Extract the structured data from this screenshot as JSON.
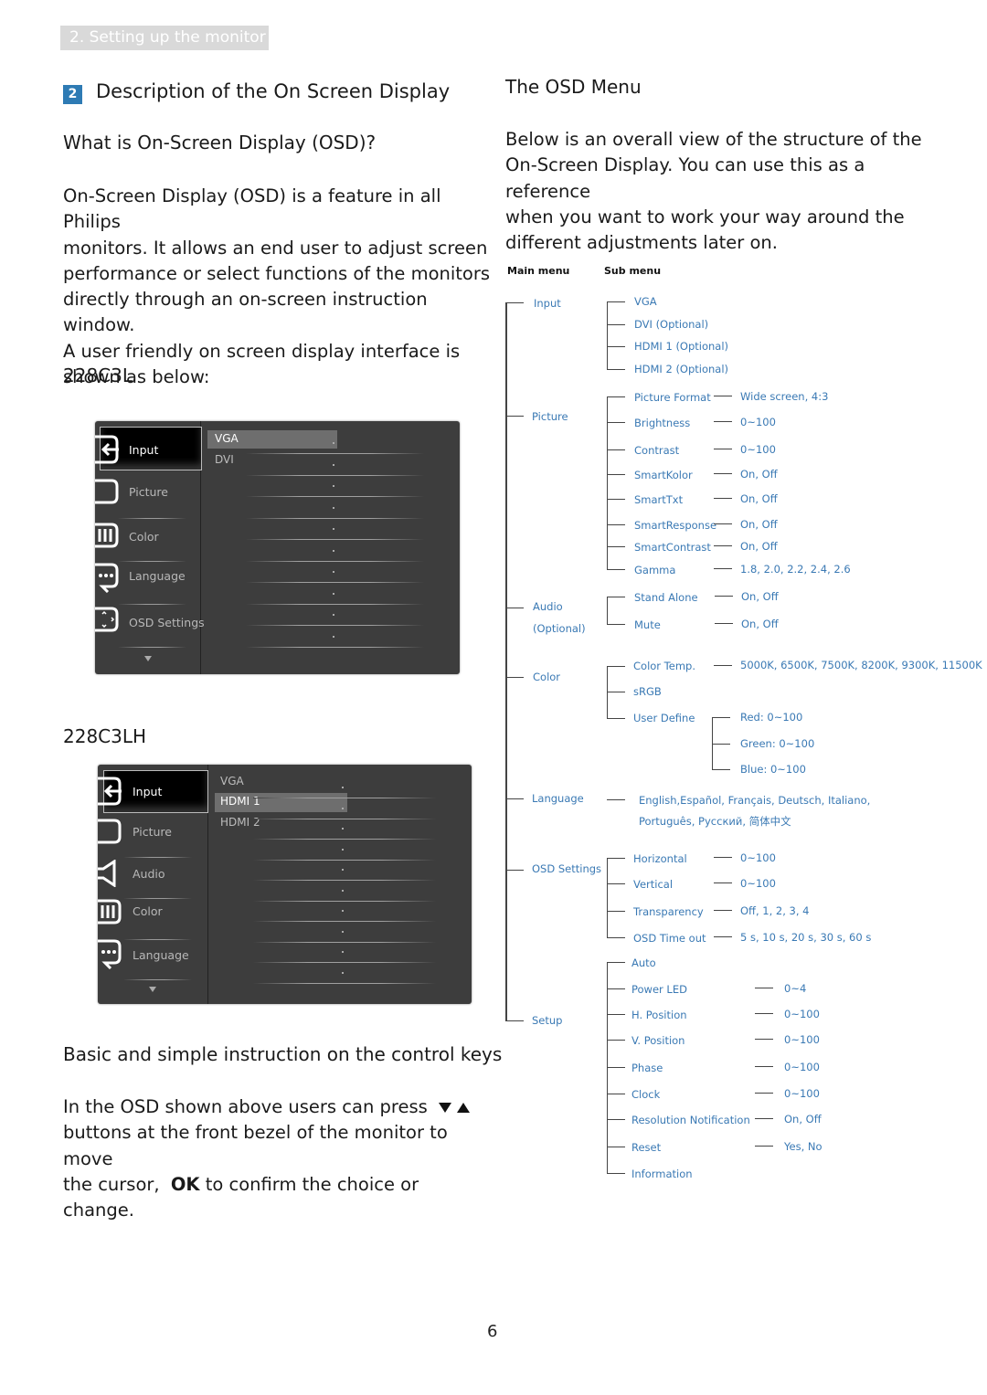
{
  "header": {
    "section_tab": "2. Setting up the monitor",
    "badge_number": "2",
    "title": "Description of the On Screen Display"
  },
  "left": {
    "question": "What is On-Screen Display (OSD)?",
    "intro_lines": [
      "On-Screen Display (OSD) is a feature in all Philips",
      "monitors. It allows an end user to adjust screen",
      "performance or select functions of the monitors",
      "directly through an on-screen instruction window.",
      "A user friendly on screen display interface is",
      "shown as below:"
    ],
    "model_a": "228C3L",
    "model_b": "228C3LH",
    "osd_a": {
      "main_items": [
        "Input",
        "Picture",
        "Color",
        "Language",
        "OSD Settings"
      ],
      "sub_items": [
        "VGA",
        "DVI"
      ],
      "active_main": "Input",
      "active_sub": "VGA"
    },
    "osd_b": {
      "main_items": [
        "Input",
        "Picture",
        "Audio",
        "Color",
        "Language"
      ],
      "sub_items": [
        "VGA",
        "HDMI 1",
        "HDMI 2"
      ],
      "active_main": "Input",
      "active_sub": "HDMI 1"
    },
    "keys_heading": "Basic and simple instruction on the control keys",
    "keys_line1": "In the OSD shown above users can press",
    "keys_line2": "buttons at the front bezel of the monitor to move",
    "keys_line3_pre": "the cursor,",
    "keys_ok": "OK",
    "keys_line3_post": "to confirm the choice or change."
  },
  "right": {
    "title": "The OSD Menu",
    "intro_lines": [
      "Below is an overall view of the structure of the",
      "On-Screen Display. You can use this as a reference",
      "when you want to work your way around the",
      "different adjustments later on."
    ],
    "col_main": "Main menu",
    "col_sub": "Sub menu",
    "tree": {
      "input": {
        "label": "Input",
        "subs": [
          "VGA",
          "DVI (Optional)",
          "HDMI 1 (Optional)",
          "HDMI 2 (Optional)"
        ]
      },
      "picture": {
        "label": "Picture",
        "subs": [
          {
            "label": "Picture Format",
            "value": "Wide screen, 4:3"
          },
          {
            "label": "Brightness",
            "value": "0~100"
          },
          {
            "label": "Contrast",
            "value": "0~100"
          },
          {
            "label": "SmartKolor",
            "value": "On, Off"
          },
          {
            "label": "SmartTxt",
            "value": "On, Off"
          },
          {
            "label": "SmartResponse",
            "value": "On, Off"
          },
          {
            "label": "SmartContrast",
            "value": "On, Off"
          },
          {
            "label": "Gamma",
            "value": "1.8, 2.0, 2.2, 2.4, 2.6"
          }
        ]
      },
      "audio": {
        "label": "Audio",
        "label2": "(Optional)",
        "subs": [
          {
            "label": "Stand Alone",
            "value": "On, Off"
          },
          {
            "label": "Mute",
            "value": "On, Off"
          }
        ]
      },
      "color": {
        "label": "Color",
        "subs": [
          {
            "label": "Color Temp.",
            "value": "5000K, 6500K, 7500K, 8200K, 9300K, 11500K"
          },
          {
            "label": "sRGB"
          },
          {
            "label": "User Define",
            "values": [
              "Red: 0~100",
              "Green: 0~100",
              "Blue: 0~100"
            ]
          }
        ]
      },
      "language": {
        "label": "Language",
        "value_line1": "English,Español, Français, Deutsch, Italiano,",
        "value_line2": "Português, Русский, 简体中文"
      },
      "osd_settings": {
        "label": "OSD Settings",
        "subs": [
          {
            "label": "Horizontal",
            "value": "0~100"
          },
          {
            "label": "Vertical",
            "value": "0~100"
          },
          {
            "label": "Transparency",
            "value": "Off, 1, 2, 3, 4"
          },
          {
            "label": "OSD Time out",
            "value": "5 s, 10 s, 20 s, 30 s, 60 s"
          }
        ]
      },
      "setup": {
        "label": "Setup",
        "subs": [
          {
            "label": "Auto"
          },
          {
            "label": "Power LED",
            "value": "0~4"
          },
          {
            "label": "H. Position",
            "value": "0~100"
          },
          {
            "label": "V. Position",
            "value": "0~100"
          },
          {
            "label": "Phase",
            "value": "0~100"
          },
          {
            "label": "Clock",
            "value": "0~100"
          },
          {
            "label": "Resolution Notification",
            "value": "On, Off"
          },
          {
            "label": "Reset",
            "value": "Yes, No"
          },
          {
            "label": "Information"
          }
        ]
      }
    }
  },
  "footer": {
    "page_number": "6"
  },
  "colors": {
    "accent": "#2e7bb4",
    "tree_text": "#3a79b4",
    "osd_bg": "#3d3d3d"
  }
}
